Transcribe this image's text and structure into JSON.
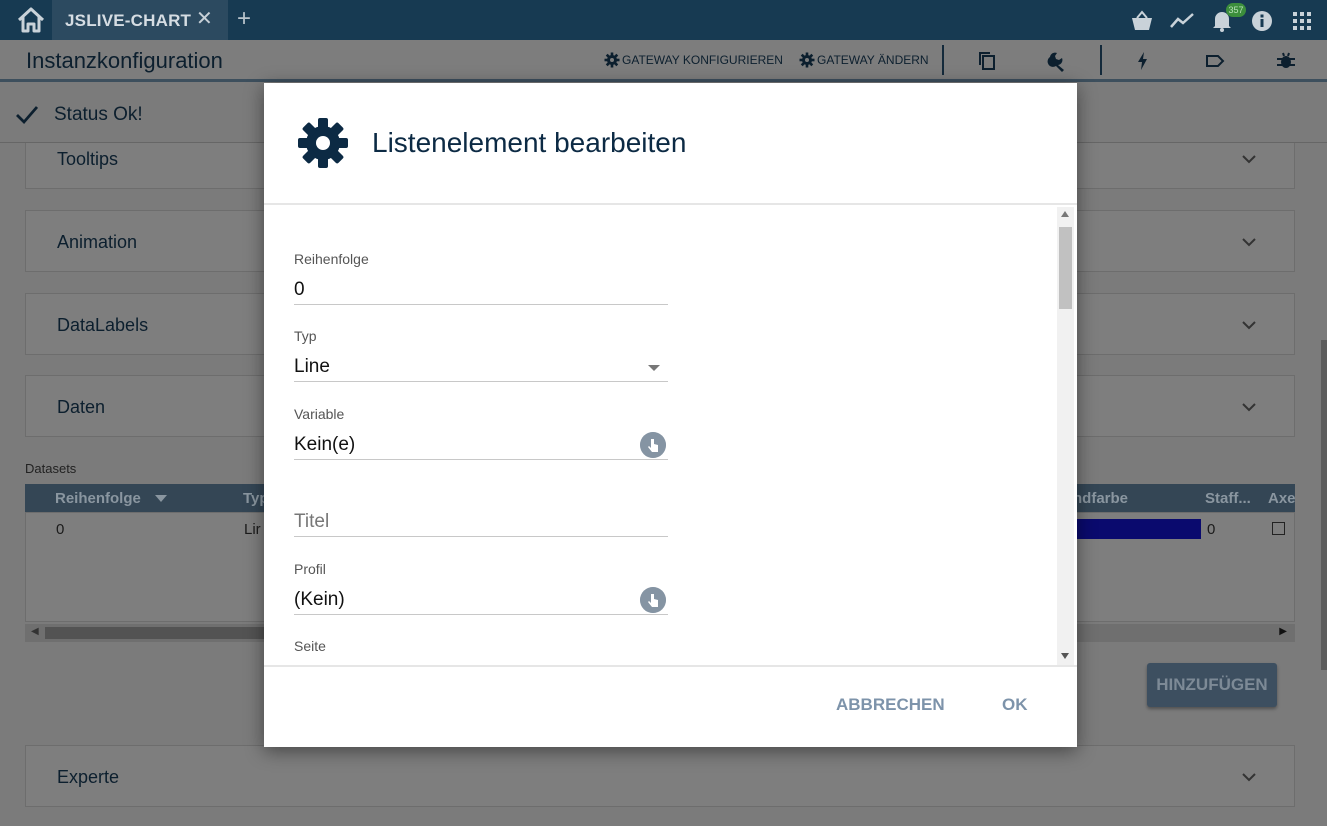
{
  "topbar": {
    "tab_label": "JSLIVE-CHART",
    "tab_close": "✕",
    "tab_add": "+",
    "notification_count": "357"
  },
  "header": {
    "title": "Instanzkonfiguration",
    "configure_gateway": "GATEWAY KONFIGURIEREN",
    "change_gateway": "GATEWAY ÄNDERN"
  },
  "status": {
    "text": "Status Ok!"
  },
  "panels": [
    "Tooltips",
    "Animation",
    "DataLabels",
    "Daten",
    "Experte"
  ],
  "datasets": {
    "label": "Datasets",
    "columns": [
      "Reihenfolge",
      "Typ",
      "ndfarbe",
      "Staff...",
      "Axe"
    ],
    "row": {
      "order": "0",
      "type": "Lir",
      "staff": "0"
    },
    "color": "#0a0a6e"
  },
  "add_button": "HINZUFÜGEN",
  "dialog": {
    "title": "Listenelement bearbeiten",
    "fields": {
      "order": {
        "label": "Reihenfolge",
        "value": "0"
      },
      "type": {
        "label": "Typ",
        "value": "Line"
      },
      "variable": {
        "label": "Variable",
        "value": "Kein(e)"
      },
      "title": {
        "label": "",
        "placeholder": "Titel"
      },
      "profile": {
        "label": "Profil",
        "value": "(Kein)"
      },
      "page": {
        "label": "Seite"
      }
    },
    "cancel": "ABBRECHEN",
    "ok": "OK"
  }
}
